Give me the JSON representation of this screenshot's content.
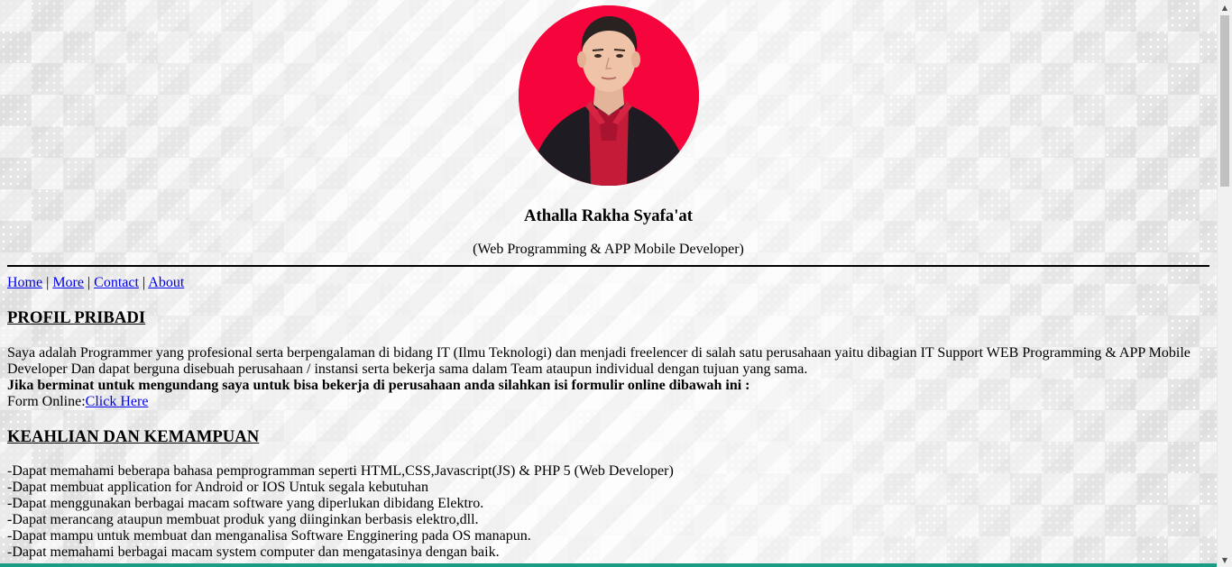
{
  "profile": {
    "name": "Athalla Rakha Syafa'at",
    "role": "(Web Programming & APP Mobile Developer)"
  },
  "nav": {
    "home": "Home",
    "more": "More",
    "contact": "Contact",
    "about": "About",
    "separator": "|"
  },
  "sections": {
    "profile_title": "PROFIL PRIBADI",
    "profile_text": "Saya adalah Programmer yang profesional serta berpengalaman di bidang IT (Ilmu Teknologi) dan menjadi freelencer di salah satu perusahaan yaitu dibagian IT Support WEB Programming & APP Mobile Developer Dan dapat berguna disebuah perusahaan / instansi serta bekerja sama dalam Team ataupun individual dengan tujuan yang sama.",
    "invite_text": "Jika berminat untuk mengundang saya untuk bisa bekerja di perusahaan anda silahkan isi formulir online dibawah ini :",
    "form_label": "Form Online:",
    "form_link": "Click Here",
    "skills_title": "KEAHLIAN DAN KEMAMPUAN",
    "skills": [
      "-Dapat memahami beberapa bahasa pemprogramman seperti HTML,CSS,Javascript(JS) & PHP 5 (Web Developer)",
      "-Dapat membuat application for Android or IOS Untuk segala kebutuhan",
      "-Dapat menggunakan berbagai macam software yang diperlukan dibidang Elektro.",
      "-Dapat merancang ataupun membuat produk yang diinginkan berbasis elektro,dll.",
      "-Dapat mampu untuk membuat dan menganalisa Software Engginering pada OS manapun.",
      "-Dapat memahami berbagai macam system computer dan mengatasinya dengan baik."
    ]
  },
  "icons": {
    "scroll_up": "scroll-up-arrow-icon",
    "scroll_down": "scroll-down-arrow-icon"
  },
  "colors": {
    "link": "#0000ee",
    "avatar_bg": "#f5053b",
    "bottom_bar": "#1a9c84"
  }
}
